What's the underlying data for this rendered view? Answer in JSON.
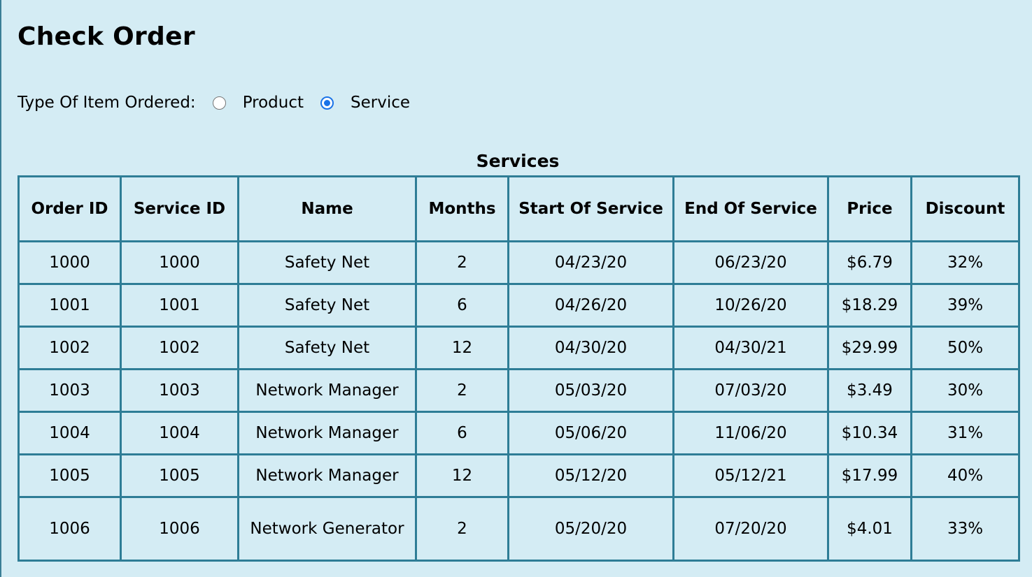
{
  "page": {
    "title": "Check Order"
  },
  "item_type": {
    "label": "Type Of Item Ordered:",
    "options": [
      {
        "label": "Product",
        "checked": false
      },
      {
        "label": "Service",
        "checked": true
      }
    ]
  },
  "services_table": {
    "caption": "Services",
    "headers": [
      "Order ID",
      "Service ID",
      "Name",
      "Months",
      "Start Of Service",
      "End Of Service",
      "Price",
      "Discount"
    ],
    "rows": [
      [
        "1000",
        "1000",
        "Safety Net",
        "2",
        "04/23/20",
        "06/23/20",
        "$6.79",
        "32%"
      ],
      [
        "1001",
        "1001",
        "Safety Net",
        "6",
        "04/26/20",
        "10/26/20",
        "$18.29",
        "39%"
      ],
      [
        "1002",
        "1002",
        "Safety Net",
        "12",
        "04/30/20",
        "04/30/21",
        "$29.99",
        "50%"
      ],
      [
        "1003",
        "1003",
        "Network Manager",
        "2",
        "05/03/20",
        "07/03/20",
        "$3.49",
        "30%"
      ],
      [
        "1004",
        "1004",
        "Network Manager",
        "6",
        "05/06/20",
        "11/06/20",
        "$10.34",
        "31%"
      ],
      [
        "1005",
        "1005",
        "Network Manager",
        "12",
        "05/12/20",
        "05/12/21",
        "$17.99",
        "40%"
      ],
      [
        "1006",
        "1006",
        "Network Generator",
        "2",
        "05/20/20",
        "07/20/20",
        "$4.01",
        "33%"
      ]
    ]
  },
  "colors": {
    "background": "#d4ecf4",
    "table_border": "#2e7d96",
    "radio_accent": "#1a73e8"
  }
}
